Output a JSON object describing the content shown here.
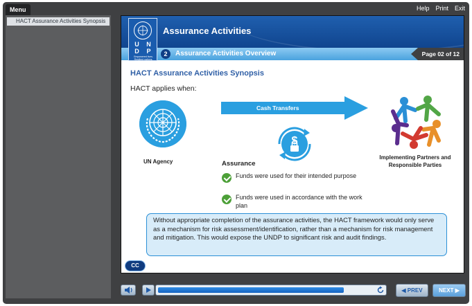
{
  "topbar": {
    "menu_label": "Menu",
    "links": {
      "help": "Help",
      "print": "Print",
      "exit": "Exit"
    }
  },
  "sidebar": {
    "items": [
      {
        "label": "HACT Assurance Activities Synopsis",
        "active": true
      }
    ]
  },
  "header": {
    "course_title": "Assurance Activities",
    "section_number": "2",
    "section_title": "Assurance Activities Overview",
    "page_indicator": "Page 02 of 12",
    "logo": {
      "letters": [
        "U",
        "N",
        "D",
        "P"
      ],
      "tagline": "Empowered lives. Resilient nations."
    }
  },
  "slide": {
    "title": "HACT Assurance Activities Synopsis",
    "applies_text": "HACT applies when:",
    "un_agency_label": "UN Agency",
    "arrow_label": "Cash Transfers",
    "assurance_heading": "Assurance",
    "assurance_items": [
      "Funds were used for their intended purpose",
      "Funds were used in accordance with the work plan"
    ],
    "partners_label": "Implementing Partners and Responsible Parties",
    "callout_text": "Without appropriate completion of the assurance activities, the HACT framework would only serve as a mechanism for risk assessment/identification, rather than a mechanism for risk management and mitigation. This would expose the UNDP to significant risk and audit findings.",
    "cc_label": "CC"
  },
  "player": {
    "progress_fraction": 0.86,
    "prev_label": "◀ PREV",
    "next_label": "NEXT ▶"
  },
  "colors": {
    "frame": "#3f4042",
    "header_blue": "#0b3c84",
    "accent_blue": "#2a9fe0",
    "check_green": "#4da038",
    "callout_bg": "#d8ecf9"
  },
  "icons": [
    "volume-icon",
    "play-icon",
    "replay-icon",
    "un-emblem-icon",
    "money-lock-icon",
    "people-circle-icon",
    "check-icon"
  ]
}
